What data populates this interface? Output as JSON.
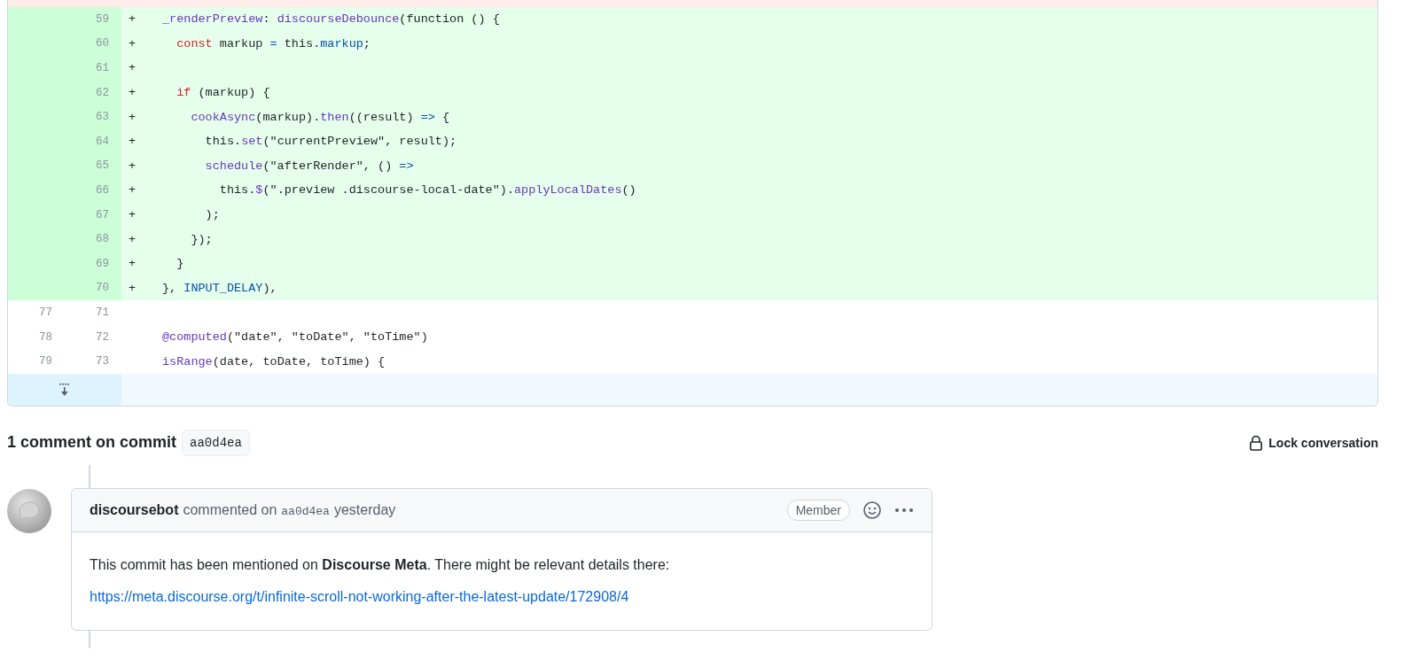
{
  "diff": {
    "lines": [
      {
        "kind": "added",
        "new": "59",
        "marker": "+",
        "tokens": [
          {
            "t": "_renderPreview",
            "kind": "func"
          },
          {
            "t": ": ",
            "kind": "plain"
          },
          {
            "t": "discourseDebounce",
            "kind": "func"
          },
          {
            "t": "(function () {",
            "kind": "plain"
          }
        ]
      },
      {
        "kind": "added",
        "new": "60",
        "marker": "+",
        "tokens": [
          {
            "t": "  const",
            "kind": "keyword"
          },
          {
            "t": " markup ",
            "kind": "plain"
          },
          {
            "t": "=",
            "kind": "const"
          },
          {
            "t": " this.",
            "kind": "plain"
          },
          {
            "t": "markup",
            "kind": "const"
          },
          {
            "t": ";",
            "kind": "plain"
          }
        ]
      },
      {
        "kind": "added",
        "new": "61",
        "marker": "+"
      },
      {
        "kind": "added",
        "new": "62",
        "marker": "+",
        "tokens": [
          {
            "t": "  if",
            "kind": "keyword"
          },
          {
            "t": " (markup) {",
            "kind": "plain"
          }
        ]
      },
      {
        "kind": "added",
        "new": "63",
        "marker": "+",
        "tokens": [
          {
            "t": "    cookAsync",
            "kind": "func"
          },
          {
            "t": "(markup).",
            "kind": "plain"
          },
          {
            "t": "then",
            "kind": "func"
          },
          {
            "t": "((result) ",
            "kind": "plain"
          },
          {
            "t": "=>",
            "kind": "const"
          },
          {
            "t": " {",
            "kind": "plain"
          }
        ]
      },
      {
        "kind": "added",
        "new": "64",
        "marker": "+",
        "tokens": [
          {
            "t": "      this.",
            "kind": "plain"
          },
          {
            "t": "set",
            "kind": "func"
          },
          {
            "t": "(\"currentPreview\", result);",
            "kind": "plain"
          }
        ]
      },
      {
        "kind": "added",
        "new": "65",
        "marker": "+",
        "tokens": [
          {
            "t": "      schedule",
            "kind": "func"
          },
          {
            "t": "(\"afterRender\", () ",
            "kind": "plain"
          },
          {
            "t": "=>",
            "kind": "const"
          }
        ]
      },
      {
        "kind": "added",
        "new": "66",
        "marker": "+",
        "tokens": [
          {
            "t": "        this.",
            "kind": "plain"
          },
          {
            "t": "$",
            "kind": "func"
          },
          {
            "t": "(\".preview .discourse-local-date\").",
            "kind": "plain"
          },
          {
            "t": "applyLocalDates",
            "kind": "func"
          },
          {
            "t": "()",
            "kind": "plain"
          }
        ]
      },
      {
        "kind": "added",
        "new": "67",
        "marker": "+",
        "tokens": [
          {
            "t": "      );",
            "kind": "plain"
          }
        ]
      },
      {
        "kind": "added",
        "new": "68",
        "marker": "+",
        "tokens": [
          {
            "t": "    });",
            "kind": "plain"
          }
        ]
      },
      {
        "kind": "added",
        "new": "69",
        "marker": "+",
        "tokens": [
          {
            "t": "  }",
            "kind": "plain"
          }
        ]
      },
      {
        "kind": "added",
        "new": "70",
        "marker": "+",
        "tokens": [
          {
            "t": "}, ",
            "kind": "plain"
          },
          {
            "t": "INPUT_DELAY",
            "kind": "const"
          },
          {
            "t": "),",
            "kind": "plain"
          }
        ]
      },
      {
        "kind": "context",
        "old": "77",
        "new": "71"
      },
      {
        "kind": "context",
        "old": "78",
        "new": "72",
        "tokens": [
          {
            "t": "@computed",
            "kind": "func"
          },
          {
            "t": "(\"date\", \"toDate\", \"toTime\")",
            "kind": "plain"
          }
        ]
      },
      {
        "kind": "context",
        "old": "79",
        "new": "73",
        "tokens": [
          {
            "t": "isRange",
            "kind": "func"
          },
          {
            "t": "(date, toDate, toTime) {",
            "kind": "plain"
          }
        ]
      }
    ]
  },
  "comments_header": {
    "title": "1 comment on commit",
    "commit": "aa0d4ea",
    "lock_action": "Lock conversation"
  },
  "comment": {
    "author": "discoursebot",
    "action": "commented on",
    "commit": "aa0d4ea",
    "time": "yesterday",
    "role_badge": "Member",
    "body": "This commit has been mentioned on **Discourse Meta**. There might be relevant details there:",
    "link": "https://meta.discourse.org/t/infinite-scroll-not-working-after-the-latest-update/172908/4"
  }
}
